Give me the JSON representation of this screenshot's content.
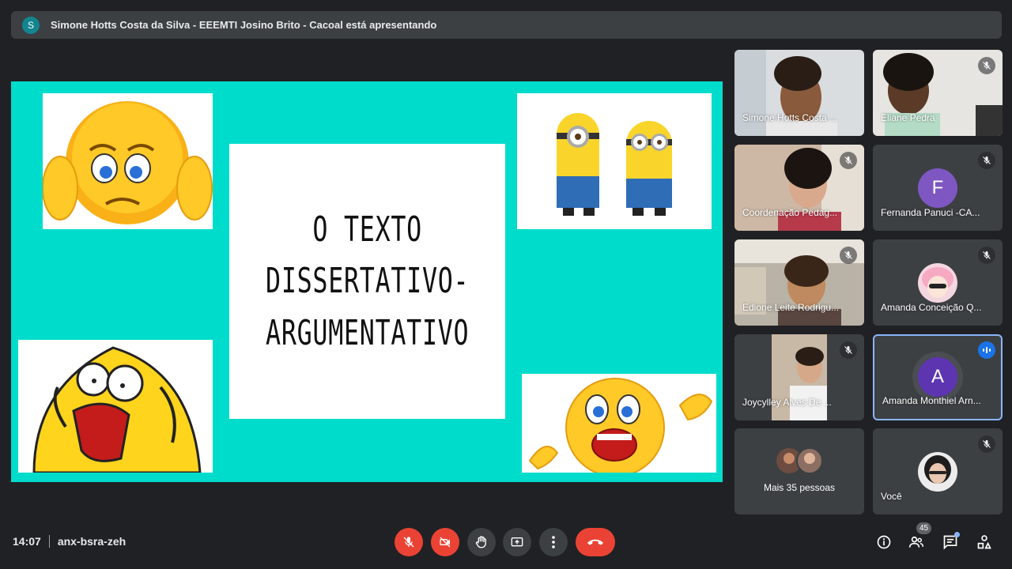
{
  "banner": {
    "avatar_letter": "S",
    "text": "Simone Hotts Costa da Silva - EEEMTI Josino Brito - Cacoal está apresentando"
  },
  "slide": {
    "title_lines": [
      "O TEXTO",
      "DISSERTATIVO-",
      "ARGUMENTATIVO"
    ]
  },
  "participants": [
    {
      "name": "Simone Hotts Costa ...",
      "muted": false
    },
    {
      "name": "Eliane Pedra",
      "muted": true
    },
    {
      "name": "Coordenação Pedag...",
      "muted": true
    },
    {
      "name": "Fernanda Panuci -CA...",
      "muted": true,
      "avatar_letter": "F",
      "avatar_color": "#7e57c2"
    },
    {
      "name": "Edione Leite Rodrigu...",
      "muted": true
    },
    {
      "name": "Amanda Conceição Q...",
      "muted": true
    },
    {
      "name": "Joycylley Alves De ...",
      "muted": true
    },
    {
      "name": "Amanda Monthiel Arn...",
      "speaking": true,
      "avatar_letter": "A",
      "avatar_color": "#5e35b1"
    },
    {
      "name": "Mais 35 pessoas"
    },
    {
      "name": "Você",
      "muted": true
    }
  ],
  "meeting": {
    "time": "14:07",
    "code": "anx-bsra-zeh"
  },
  "controls": {
    "mic": "mic-off-icon",
    "camera": "camera-off-icon",
    "hand": "raise-hand-icon",
    "present": "present-screen-icon",
    "more": "more-options-icon",
    "hangup": "hang-up-icon"
  },
  "right_controls": {
    "people_count": "45"
  },
  "colors": {
    "accent": "#8ab4f8",
    "danger": "#ea4335",
    "slide_bg": "#00dccb"
  }
}
